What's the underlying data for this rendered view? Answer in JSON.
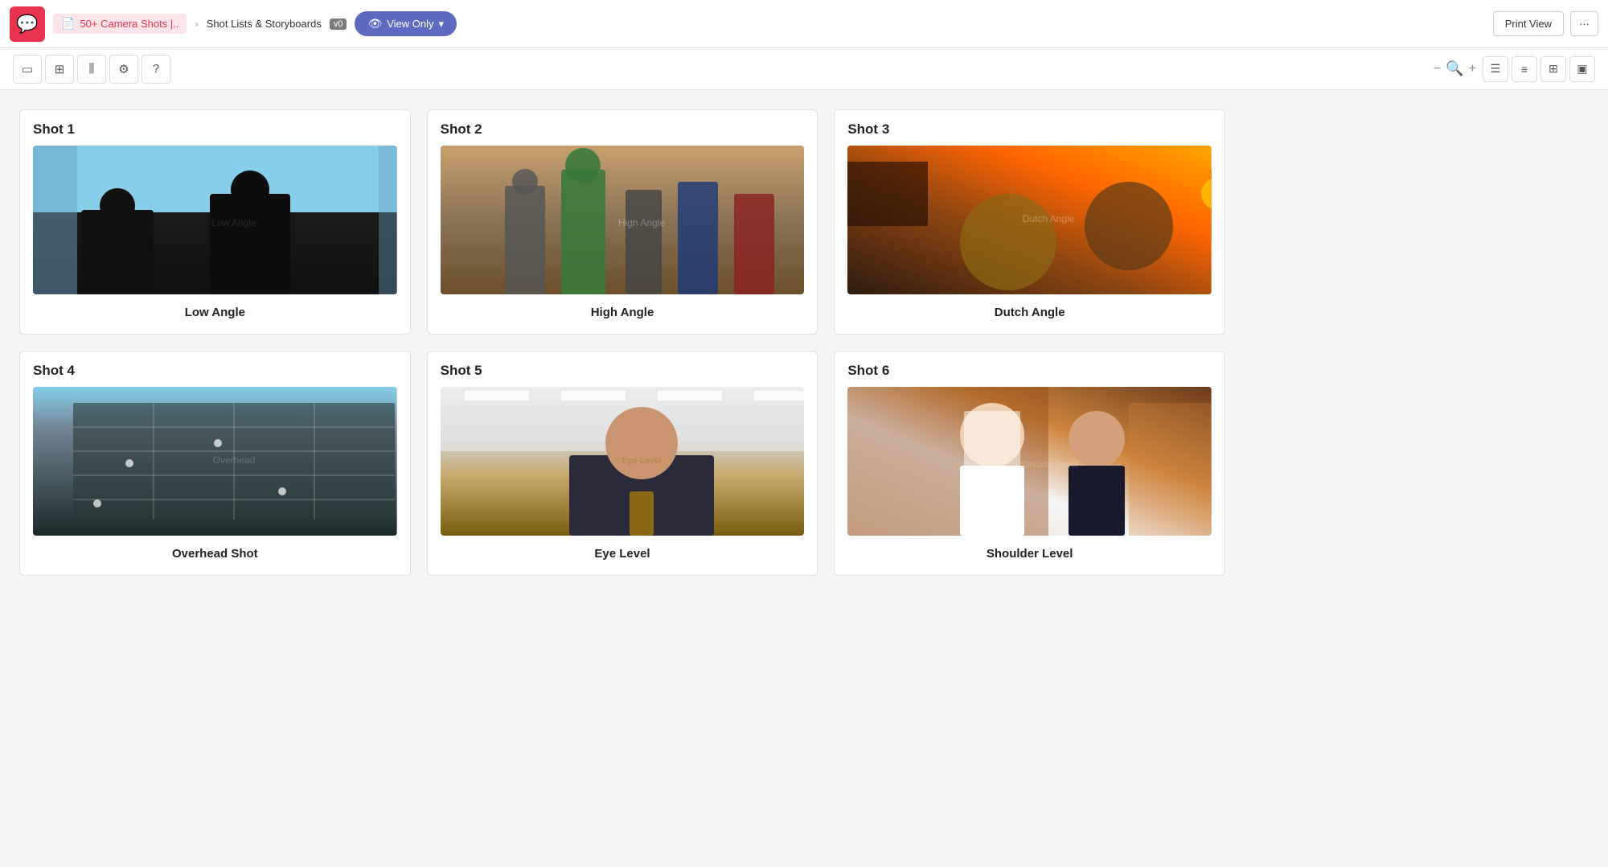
{
  "header": {
    "logo_icon": "💬",
    "doc_label": "50+ Camera Shots |..",
    "separator": "›",
    "breadcrumb_current": "Shot Lists & Storyboards",
    "version_badge": "v0",
    "view_only_label": "View Only",
    "print_label": "Print View",
    "more_icon": "···"
  },
  "toolbar": {
    "tools": [
      {
        "name": "single-column-icon",
        "icon": "▭",
        "label": "Single column"
      },
      {
        "name": "grid-icon",
        "icon": "⊞",
        "label": "Grid"
      },
      {
        "name": "columns-icon",
        "icon": "⫼",
        "label": "Columns"
      },
      {
        "name": "settings-icon",
        "icon": "⚙",
        "label": "Settings"
      },
      {
        "name": "help-icon",
        "icon": "?",
        "label": "Help"
      }
    ],
    "zoom_minus": "−",
    "zoom_plus": "+",
    "view_modes": [
      {
        "name": "view-rows",
        "icon": "☰"
      },
      {
        "name": "view-list",
        "icon": "≡"
      },
      {
        "name": "view-grid",
        "icon": "⊞"
      },
      {
        "name": "view-full",
        "icon": "▣"
      }
    ]
  },
  "shots": [
    {
      "id": "shot-1",
      "title": "Shot 1",
      "label": "Low Angle",
      "img_style": "img-shot1",
      "img_description": "Low angle shot from Pulp Fiction - two men in suits viewed from below against blue sky"
    },
    {
      "id": "shot-2",
      "title": "Shot 2",
      "label": "High Angle",
      "img_style": "img-shot2",
      "img_description": "High angle shot from The Avengers - heroes walking forward"
    },
    {
      "id": "shot-3",
      "title": "Shot 3",
      "label": "Dutch Angle",
      "img_style": "img-shot3",
      "img_description": "Dutch angle selfie shot from Do the Right Thing"
    },
    {
      "id": "shot-4",
      "title": "Shot 4",
      "label": "Overhead Shot",
      "img_style": "img-shot4",
      "img_description": "Overhead shot showing building exterior with people"
    },
    {
      "id": "shot-5",
      "title": "Shot 5",
      "label": "Eye Level",
      "img_style": "img-shot5",
      "img_description": "Eye level shot from Wolf of Wall Street - man in suit smiling"
    },
    {
      "id": "shot-6",
      "title": "Shot 6",
      "label": "Shoulder Level",
      "img_style": "img-shot6",
      "img_description": "Shoulder level shot of couple in wedding attire"
    }
  ]
}
